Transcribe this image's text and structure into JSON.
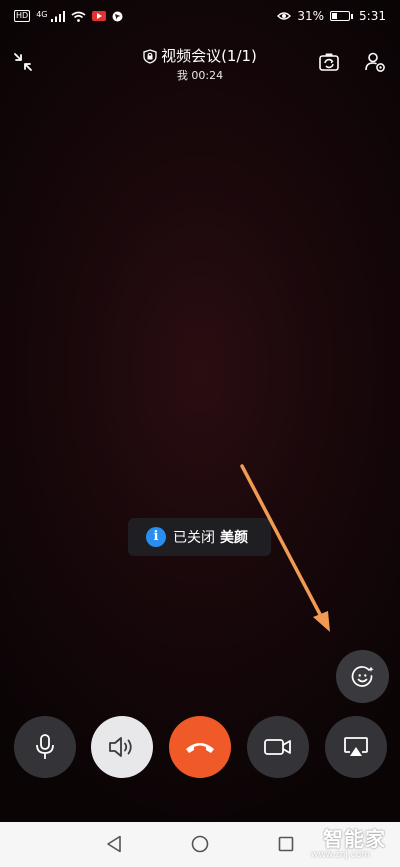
{
  "status_bar": {
    "hd": "HD",
    "network": "4G",
    "battery_percent_text": "31%",
    "battery_level": 0.31,
    "time": "5:31"
  },
  "header": {
    "title": "视频会议(1/1)",
    "subtitle": "我 00:24"
  },
  "toast": {
    "text": "已关闭",
    "highlight": "美颜"
  },
  "controls": [
    {
      "name": "mic-button",
      "icon": "microphone-icon"
    },
    {
      "name": "speaker-button",
      "icon": "speaker-icon"
    },
    {
      "name": "hangup-button",
      "icon": "hangup-icon"
    },
    {
      "name": "camera-button",
      "icon": "video-camera-icon"
    },
    {
      "name": "screen-share-button",
      "icon": "screen-share-icon"
    }
  ],
  "colors": {
    "hangup": "#f05a28",
    "annotation_arrow": "#f09a52",
    "info_icon": "#2a8ef0"
  },
  "watermark": {
    "text": "智能家",
    "url": "www.znj.com"
  }
}
